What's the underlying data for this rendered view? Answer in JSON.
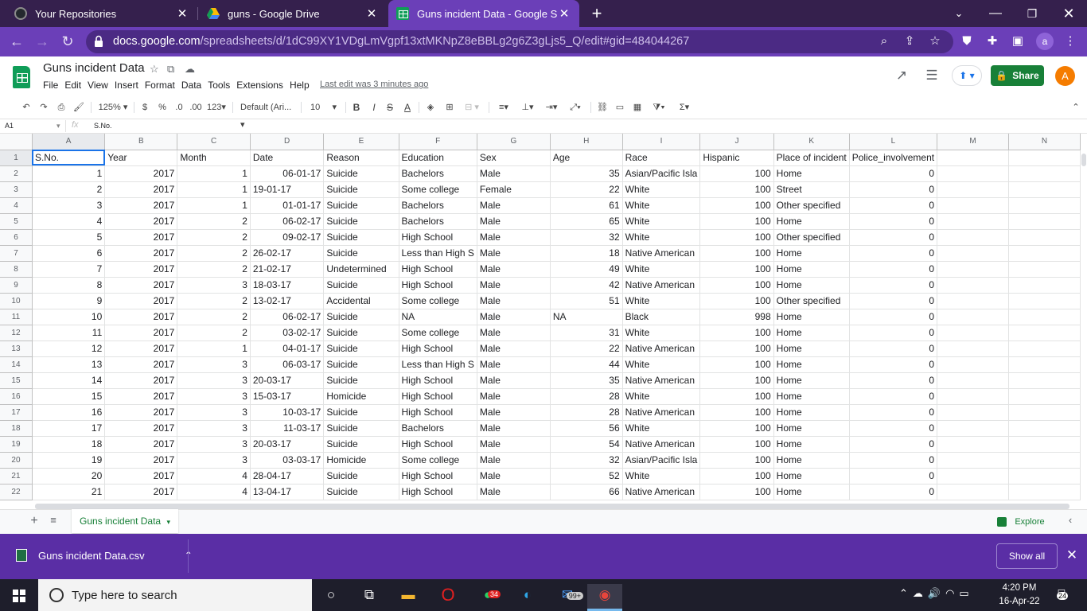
{
  "browser": {
    "tabs": [
      {
        "title": "Your Repositories",
        "icon": "github-icon"
      },
      {
        "title": "guns - Google Drive",
        "icon": "google-drive-icon"
      },
      {
        "title": "Guns incident Data - Google She",
        "icon": "google-sheets-icon"
      }
    ],
    "url_domain": "docs.google.com",
    "url_path": "/spreadsheets/d/1dC99XY1VDgLmVgpf13xtMKNpZ8eBBLg2g6Z3gLjs5_Q/edit#gid=484044267",
    "profile_initial": "a"
  },
  "doc": {
    "title": "Guns incident Data",
    "menu": [
      "File",
      "Edit",
      "View",
      "Insert",
      "Format",
      "Data",
      "Tools",
      "Extensions",
      "Help"
    ],
    "last_edit": "Last edit was 3 minutes ago",
    "share_label": "Share",
    "avatar_initial": "A"
  },
  "toolbar": {
    "zoom": "125%",
    "currency": "$",
    "percent": "%",
    "dec_less": ".0",
    "dec_more": ".00",
    "more_formats": "123",
    "font": "Default (Ari...",
    "font_size": "10",
    "bold": "B",
    "italic": "I",
    "strike": "S",
    "text_color": "A"
  },
  "formula_bar": {
    "cell_ref": "A1",
    "fx": "fx",
    "value": "S.No."
  },
  "grid": {
    "columns": [
      "A",
      "B",
      "C",
      "D",
      "E",
      "F",
      "G",
      "H",
      "I",
      "J",
      "K",
      "L",
      "M",
      "N"
    ],
    "rows": [
      [
        "S.No.",
        "Year",
        "Month",
        "Date",
        "Reason",
        "Education",
        "Sex",
        "Age",
        "Race",
        "Hispanic",
        "Place of incident",
        "Police_involvement",
        "",
        ""
      ],
      [
        "1",
        "2017",
        "1",
        "06-01-17",
        "Suicide",
        "Bachelors",
        "Male",
        "35",
        "Asian/Pacific Isla",
        "100",
        "Home",
        "0",
        "",
        ""
      ],
      [
        "2",
        "2017",
        "1",
        "19-01-17",
        "Suicide",
        "Some college",
        "Female",
        "22",
        "White",
        "100",
        "Street",
        "0",
        "",
        ""
      ],
      [
        "3",
        "2017",
        "1",
        "01-01-17",
        "Suicide",
        "Bachelors",
        "Male",
        "61",
        "White",
        "100",
        "Other specified",
        "0",
        "",
        ""
      ],
      [
        "4",
        "2017",
        "2",
        "06-02-17",
        "Suicide",
        "Bachelors",
        "Male",
        "65",
        "White",
        "100",
        "Home",
        "0",
        "",
        ""
      ],
      [
        "5",
        "2017",
        "2",
        "09-02-17",
        "Suicide",
        "High School",
        "Male",
        "32",
        "White",
        "100",
        "Other specified",
        "0",
        "",
        ""
      ],
      [
        "6",
        "2017",
        "2",
        "26-02-17",
        "Suicide",
        "Less than High S",
        "Male",
        "18",
        "Native American",
        "100",
        "Home",
        "0",
        "",
        ""
      ],
      [
        "7",
        "2017",
        "2",
        "21-02-17",
        "Undetermined",
        "High School",
        "Male",
        "49",
        "White",
        "100",
        "Home",
        "0",
        "",
        ""
      ],
      [
        "8",
        "2017",
        "3",
        "18-03-17",
        "Suicide",
        "High School",
        "Male",
        "42",
        "Native American",
        "100",
        "Home",
        "0",
        "",
        ""
      ],
      [
        "9",
        "2017",
        "2",
        "13-02-17",
        "Accidental",
        "Some college",
        "Male",
        "51",
        "White",
        "100",
        "Other specified",
        "0",
        "",
        ""
      ],
      [
        "10",
        "2017",
        "2",
        "06-02-17",
        "Suicide",
        "NA",
        "Male",
        "NA",
        "Black",
        "998",
        "Home",
        "0",
        "",
        ""
      ],
      [
        "11",
        "2017",
        "2",
        "03-02-17",
        "Suicide",
        "Some college",
        "Male",
        "31",
        "White",
        "100",
        "Home",
        "0",
        "",
        ""
      ],
      [
        "12",
        "2017",
        "1",
        "04-01-17",
        "Suicide",
        "High School",
        "Male",
        "22",
        "Native American",
        "100",
        "Home",
        "0",
        "",
        ""
      ],
      [
        "13",
        "2017",
        "3",
        "06-03-17",
        "Suicide",
        "Less than High S",
        "Male",
        "44",
        "White",
        "100",
        "Home",
        "0",
        "",
        ""
      ],
      [
        "14",
        "2017",
        "3",
        "20-03-17",
        "Suicide",
        "High School",
        "Male",
        "35",
        "Native American",
        "100",
        "Home",
        "0",
        "",
        ""
      ],
      [
        "15",
        "2017",
        "3",
        "15-03-17",
        "Homicide",
        "High School",
        "Male",
        "28",
        "White",
        "100",
        "Home",
        "0",
        "",
        ""
      ],
      [
        "16",
        "2017",
        "3",
        "10-03-17",
        "Suicide",
        "High School",
        "Male",
        "28",
        "Native American",
        "100",
        "Home",
        "0",
        "",
        ""
      ],
      [
        "17",
        "2017",
        "3",
        "11-03-17",
        "Suicide",
        "Bachelors",
        "Male",
        "56",
        "White",
        "100",
        "Home",
        "0",
        "",
        ""
      ],
      [
        "18",
        "2017",
        "3",
        "20-03-17",
        "Suicide",
        "High School",
        "Male",
        "54",
        "Native American",
        "100",
        "Home",
        "0",
        "",
        ""
      ],
      [
        "19",
        "2017",
        "3",
        "03-03-17",
        "Homicide",
        "Some college",
        "Male",
        "32",
        "Asian/Pacific Isla",
        "100",
        "Home",
        "0",
        "",
        ""
      ],
      [
        "20",
        "2017",
        "4",
        "28-04-17",
        "Suicide",
        "High School",
        "Male",
        "52",
        "White",
        "100",
        "Home",
        "0",
        "",
        ""
      ],
      [
        "21",
        "2017",
        "4",
        "13-04-17",
        "Suicide",
        "High School",
        "Male",
        "66",
        "Native American",
        "100",
        "Home",
        "0",
        "",
        ""
      ]
    ]
  },
  "sheet_tabs": {
    "active": "Guns incident Data",
    "explore": "Explore"
  },
  "downloads": {
    "file": "Guns incident Data.csv",
    "show_all": "Show all"
  },
  "taskbar": {
    "search_placeholder": "Type here to search",
    "whatsapp_badge": "34",
    "mail_badge": "99+",
    "time": "4:20 PM",
    "date": "16-Apr-22",
    "notifications": "24"
  },
  "colors": {
    "accent": "#6b3fb8",
    "sheets_green": "#0f9d58",
    "share_green": "#188038",
    "selection": "#1a73e8"
  }
}
